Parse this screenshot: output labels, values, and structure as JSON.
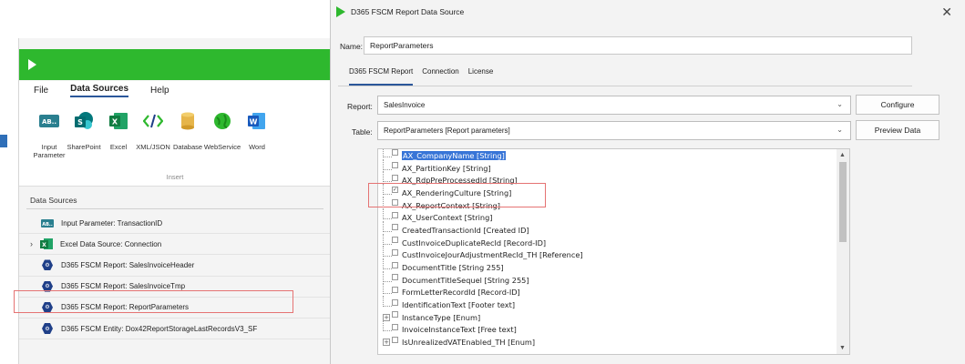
{
  "background": {
    "ribbon_tabs": [
      "File",
      "Data Sources",
      "Help"
    ],
    "ribbon_buttons": [
      {
        "label": "Input\nParameter",
        "icon": "input-parameter-icon"
      },
      {
        "label": "SharePoint",
        "icon": "sharepoint-icon"
      },
      {
        "label": "Excel",
        "icon": "excel-icon"
      },
      {
        "label": "XML/JSON",
        "icon": "xml-json-icon"
      },
      {
        "label": "Database",
        "icon": "database-icon"
      },
      {
        "label": "WebService",
        "icon": "webservice-icon"
      },
      {
        "label": "Word",
        "icon": "word-icon"
      }
    ],
    "ribbon_group": "Insert",
    "ds_header": "Data Sources",
    "ds_items": [
      "Input Parameter: TransactionID",
      "Excel Data Source: Connection",
      "D365 FSCM Report: SalesInvoiceHeader",
      "D365 FSCM Report: SalesInvoiceTmp",
      "D365 FSCM Report: ReportParameters",
      "D365 FSCM Entity: Dox42ReportStorageLastRecordsV3_SF"
    ]
  },
  "dialog": {
    "title": "D365 FSCM Report Data Source",
    "name_label": "Name:",
    "name_value": "ReportParameters",
    "tabs": [
      "D365 FSCM Report",
      "Connection",
      "License"
    ],
    "report_label": "Report:",
    "report_value": "SalesInvoice",
    "table_label": "Table:",
    "table_value": "ReportParameters [Report parameters]",
    "configure_label": "Configure",
    "preview_label": "Preview Data",
    "fields": [
      {
        "text": "AX_CompanyName [String]",
        "checked": false,
        "selected": true,
        "expandable": false
      },
      {
        "text": "AX_PartitionKey [String]",
        "checked": false,
        "selected": false,
        "expandable": false
      },
      {
        "text": "AX_RdpPreProcessedId [String]",
        "checked": false,
        "selected": false,
        "expandable": false
      },
      {
        "text": "AX_RenderingCulture [String]",
        "checked": true,
        "selected": false,
        "expandable": false
      },
      {
        "text": "AX_ReportContext [String]",
        "checked": false,
        "selected": false,
        "expandable": false
      },
      {
        "text": "AX_UserContext [String]",
        "checked": false,
        "selected": false,
        "expandable": false
      },
      {
        "text": "CreatedTransactionId [Created ID]",
        "checked": false,
        "selected": false,
        "expandable": false
      },
      {
        "text": "CustInvoiceDuplicateRecId [Record-ID]",
        "checked": false,
        "selected": false,
        "expandable": false
      },
      {
        "text": "CustInvoiceJourAdjustmentRecId_TH [Reference]",
        "checked": false,
        "selected": false,
        "expandable": false
      },
      {
        "text": "DocumentTitle [String 255]",
        "checked": false,
        "selected": false,
        "expandable": false
      },
      {
        "text": "DocumentTitleSequel [String 255]",
        "checked": false,
        "selected": false,
        "expandable": false
      },
      {
        "text": "FormLetterRecordId [Record-ID]",
        "checked": false,
        "selected": false,
        "expandable": false
      },
      {
        "text": "IdentificationText [Footer text]",
        "checked": false,
        "selected": false,
        "expandable": false
      },
      {
        "text": "InstanceType [Enum]",
        "checked": false,
        "selected": false,
        "expandable": true
      },
      {
        "text": "InvoiceInstanceText [Free text]",
        "checked": false,
        "selected": false,
        "expandable": false
      },
      {
        "text": "IsUnrealizedVATEnabled_TH [Enum]",
        "checked": false,
        "selected": false,
        "expandable": true
      }
    ]
  },
  "colors": {
    "green": "#2eb82e",
    "highlight": "#e57373",
    "selection": "#3875d7"
  }
}
